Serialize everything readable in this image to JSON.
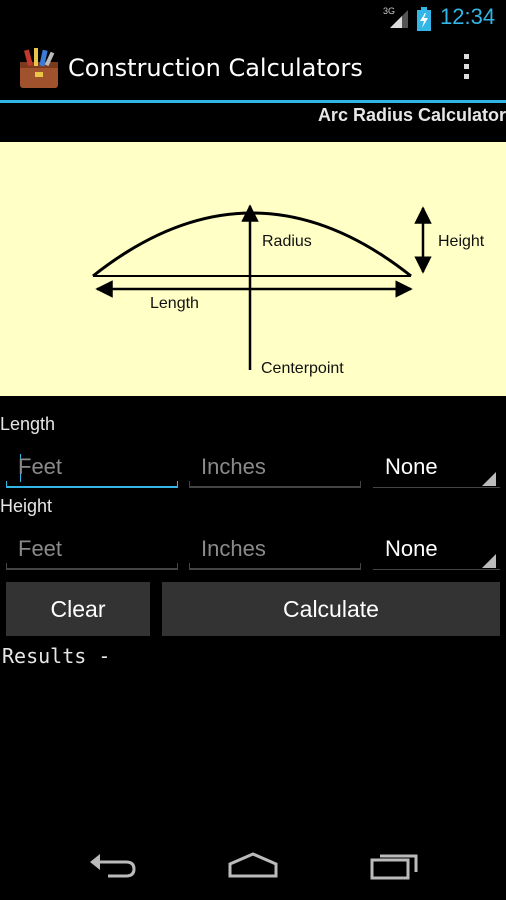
{
  "status_bar": {
    "network": "3G",
    "time": "12:34",
    "icons": [
      "signal-icon",
      "battery-charging-icon"
    ]
  },
  "action_bar": {
    "title": "Construction Calculators",
    "icon": "toolbox-app-icon",
    "overflow_icon": "overflow-menu-icon"
  },
  "section": {
    "title": "Arc Radius Calculator"
  },
  "diagram": {
    "labels": {
      "radius": "Radius",
      "height": "Height",
      "length": "Length",
      "centerpoint": "Centerpoint"
    },
    "background": "#ffffc6"
  },
  "length": {
    "label": "Length",
    "feet_placeholder": "Feet",
    "inches_placeholder": "Inches",
    "fraction_selected": "None"
  },
  "height": {
    "label": "Height",
    "feet_placeholder": "Feet",
    "inches_placeholder": "Inches",
    "fraction_selected": "None"
  },
  "buttons": {
    "clear": "Clear",
    "calculate": "Calculate"
  },
  "results": {
    "label": "Results -"
  },
  "nav_bar": {
    "icons": [
      "back-icon",
      "home-icon",
      "recent-apps-icon"
    ]
  },
  "colors": {
    "accent": "#33b5e5",
    "background": "#000000",
    "button": "#333333"
  }
}
